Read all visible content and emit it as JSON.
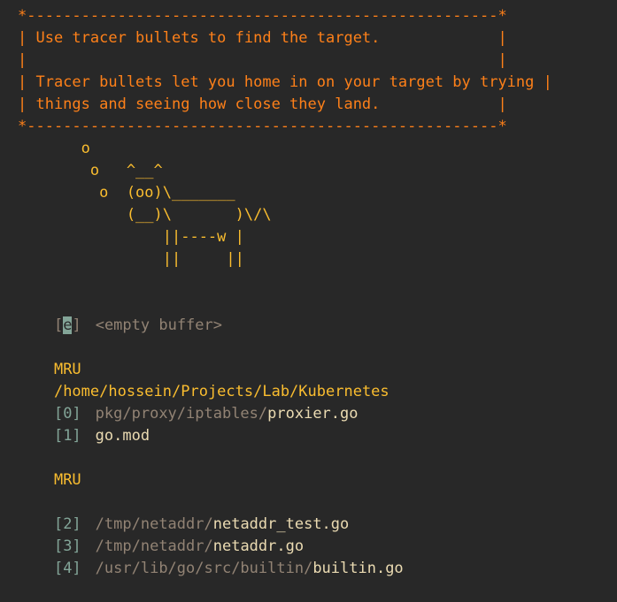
{
  "banner": {
    "border_top": "*----------------------------------------------------*",
    "border_bottom": "*----------------------------------------------------*",
    "lines": [
      "| Use tracer bullets to find the target.             |",
      "|                                                    |",
      "| Tracer bullets let you home in on your target by trying |",
      "| things and seeing how close they land.             |"
    ]
  },
  "cowsay": {
    "lines": [
      "       o",
      "        o   ^__^",
      "         o  (oo)\\_______",
      "            (__)\\       )\\/\\",
      "                ||----w |",
      "                ||     ||"
    ]
  },
  "empty_entry": {
    "bracket_open": "[",
    "key": "e",
    "bracket_close": "]",
    "label": "<empty buffer>"
  },
  "sections": [
    {
      "header": "MRU",
      "path": "/home/hossein/Projects/Lab/Kubernetes",
      "items": [
        {
          "index": "[0]",
          "dir": "pkg/proxy/iptables/",
          "file": "proxier.go"
        },
        {
          "index": "[1]",
          "dir": "",
          "file": "go.mod"
        }
      ]
    },
    {
      "header": "MRU",
      "path": "",
      "items": [
        {
          "index": "[2]",
          "dir": "/tmp/netaddr/",
          "file": "netaddr_test.go"
        },
        {
          "index": "[3]",
          "dir": "/tmp/netaddr/",
          "file": "netaddr.go"
        },
        {
          "index": "[4]",
          "dir": "/usr/lib/go/src/builtin/",
          "file": "builtin.go"
        }
      ]
    }
  ],
  "colors": {
    "background": "#282828",
    "banner": "#fe8019",
    "header": "#fabd2f",
    "index": "#83a598",
    "dim": "#928374",
    "text": "#ebdbb2"
  }
}
